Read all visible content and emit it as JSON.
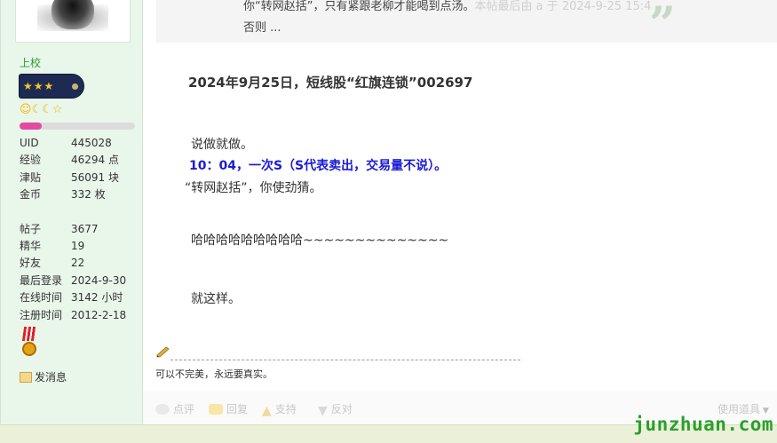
{
  "profile": {
    "rank": "上校",
    "stats": [
      {
        "label": "UID",
        "value": "445028"
      },
      {
        "label": "经验",
        "value": "46294 点"
      },
      {
        "label": "津贴",
        "value": "56091 块"
      },
      {
        "label": "金币",
        "value": "332 枚"
      }
    ],
    "stats2": [
      {
        "label": "帖子",
        "value": "3677"
      },
      {
        "label": "精华",
        "value": "19"
      },
      {
        "label": "好友",
        "value": "22"
      },
      {
        "label": "最后登录",
        "value": "2024-9-30"
      },
      {
        "label": "在线时间",
        "value": "3142 小时"
      },
      {
        "label": "注册时间",
        "value": "2012-2-18"
      }
    ],
    "level_progress": 0.19,
    "send_message": "发消息"
  },
  "quote": {
    "line1": "你“转网赵括”，只有紧跟老柳才能喝到点汤。",
    "line1_faint": "本帖最后由 a 于 2024-9-25 15:4",
    "line2": "否则 ..."
  },
  "post": {
    "title": "2024年9月25日，短线股“红旗连锁”002697",
    "p1": "说做就做。",
    "p2": "10：04，一次S（S代表卖出，交易量不说）。",
    "p3": "“转网赵括”，你使劲猜。",
    "p4": "哈哈哈哈哈哈哈哈哈~~~~~~~~~~~~~~",
    "p5": "就这样。",
    "signature": "可以不完美，永远要真实。"
  },
  "actions": {
    "rate": "点评",
    "reply": "回复",
    "support": "支持",
    "oppose": "反对",
    "tools": "使用道具"
  },
  "watermark": "junzhuan.com"
}
